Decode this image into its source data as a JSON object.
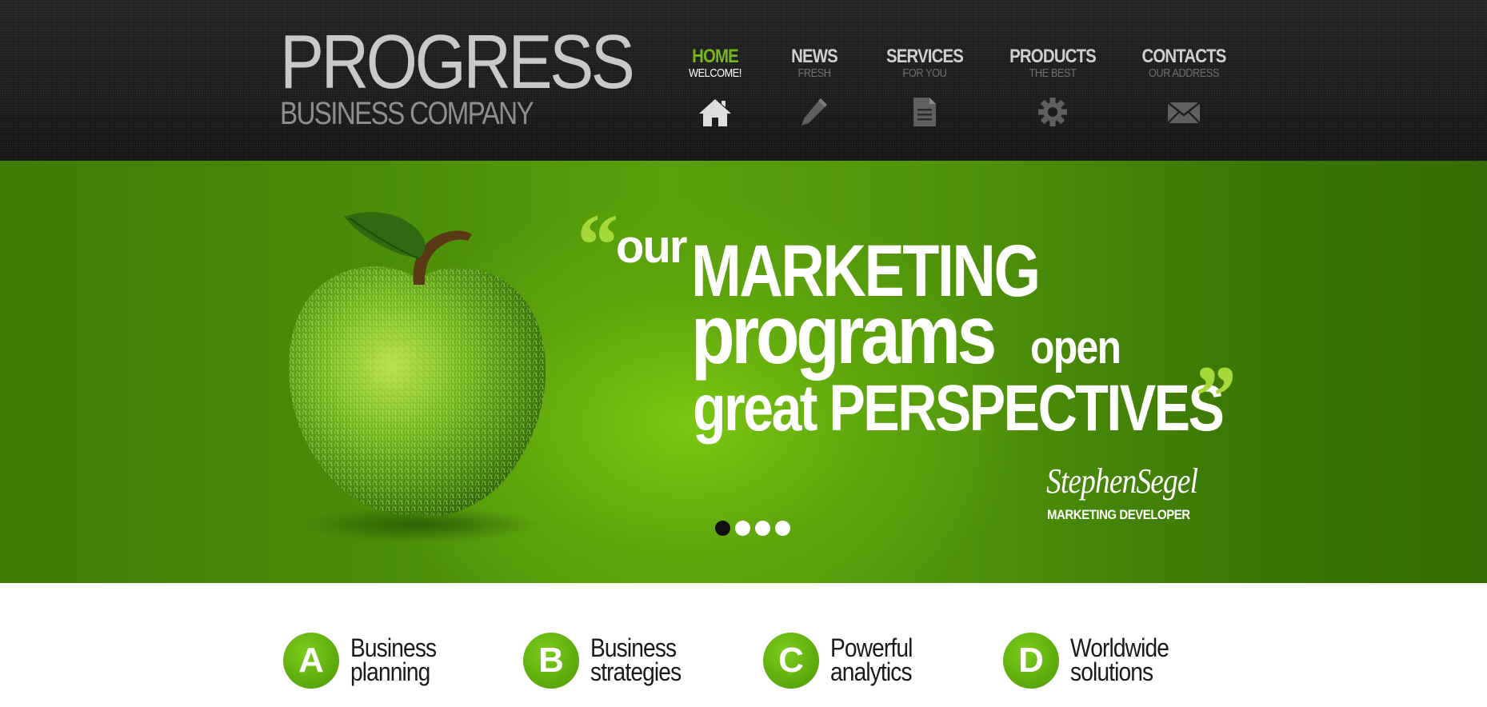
{
  "logo": {
    "title": "PROGRESS",
    "subtitle": "BUSINESS COMPANY"
  },
  "nav": {
    "items": [
      {
        "label": "HOME",
        "sub": "WELCOME!",
        "icon": "home-icon",
        "active": true
      },
      {
        "label": "NEWS",
        "sub": "FRESH",
        "icon": "pencil-icon",
        "active": false
      },
      {
        "label": "SERVICES",
        "sub": "FOR YOU",
        "icon": "document-icon",
        "active": false
      },
      {
        "label": "PRODUCTS",
        "sub": "THE BEST",
        "icon": "gear-icon",
        "active": false
      },
      {
        "label": "CONTACTS",
        "sub": "OUR ADDRESS",
        "icon": "envelope-icon",
        "active": false
      }
    ]
  },
  "hero": {
    "quote_open": "“",
    "quote_close": "”",
    "line_our": "our",
    "line_marketing": "MARKETING",
    "line_programs": "programs",
    "line_open": "open",
    "line_perspectives": "great PERSPECTIVES",
    "author_name": "StephenSegel",
    "author_role": "MARKETING DEVELOPER",
    "slides_total": 4,
    "slide_active": 1
  },
  "features": [
    {
      "letter": "A",
      "line1": "Business",
      "line2": "planning"
    },
    {
      "letter": "B",
      "line1": "Business",
      "line2": "strategies"
    },
    {
      "letter": "C",
      "line1": "Powerful",
      "line2": "analytics"
    },
    {
      "letter": "D",
      "line1": "Worldwide",
      "line2": "solutions"
    }
  ],
  "colors": {
    "accent": "#74b81a",
    "header_bg": "#1b1b1b",
    "hero_green": "#5ea50c",
    "badge_green": "#5aa80c"
  }
}
